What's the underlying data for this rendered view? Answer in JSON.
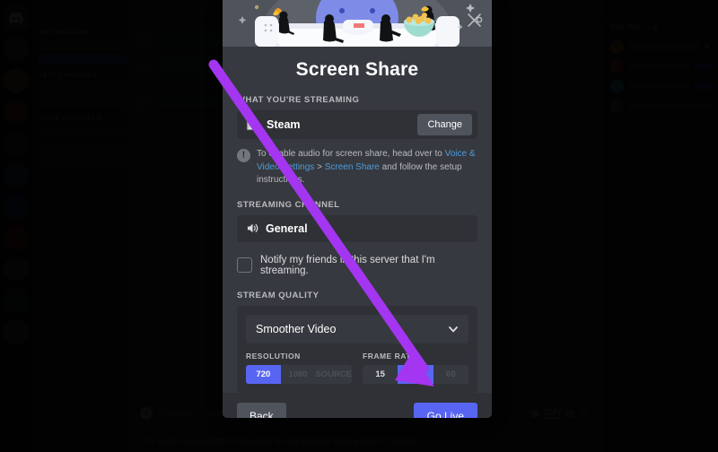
{
  "background": {
    "members_title": "ONLINE — 4",
    "composer_placeholder": "Message #general",
    "gif_label": "GIF",
    "hint_text": "Try slash commands! A new way to use bots by typing slash.",
    "hint_link": "Dismiss",
    "channel_categories": [
      "INFORMATION",
      "TEXT CHANNELS",
      "VOICE CHANNELS"
    ]
  },
  "modal": {
    "title": "Screen Share",
    "close_label": "×",
    "streaming": {
      "section_label": "WHAT YOU'RE STREAMING",
      "source_name": "Steam",
      "change_label": "Change"
    },
    "note": {
      "icon_glyph": "!",
      "prefix": "To enable audio for screen share, head over to ",
      "link_1": "Voice & Video Settings",
      "middle": " > ",
      "link_2": "Screen Share",
      "suffix": " and follow the setup instructions."
    },
    "channel": {
      "section_label": "STREAMING CHANNEL",
      "name": "General"
    },
    "notify": {
      "label": "Notify my friends in this server that I'm streaming.",
      "checked": false
    },
    "quality": {
      "section_label": "STREAM QUALITY",
      "preset": "Smoother Video",
      "resolution": {
        "label": "RESOLUTION",
        "options": [
          {
            "label": "720",
            "state": "active"
          },
          {
            "label": "1080",
            "state": "disabled"
          },
          {
            "label": "SOURCE",
            "state": "disabled"
          }
        ]
      },
      "framerate": {
        "label": "FRAME RATE",
        "options": [
          {
            "label": "15",
            "state": "enabled"
          },
          {
            "label": "30",
            "state": "active"
          },
          {
            "label": "60",
            "state": "disabled"
          }
        ]
      }
    },
    "footer": {
      "back_label": "Back",
      "golive_label": "Go Live"
    }
  },
  "colors": {
    "accent_blurple": "#5865f2",
    "modal_bg": "#36393f",
    "field_bg": "#2f3136",
    "annotation_purple": "#a435f0",
    "link_blue": "#4f9bd9"
  }
}
